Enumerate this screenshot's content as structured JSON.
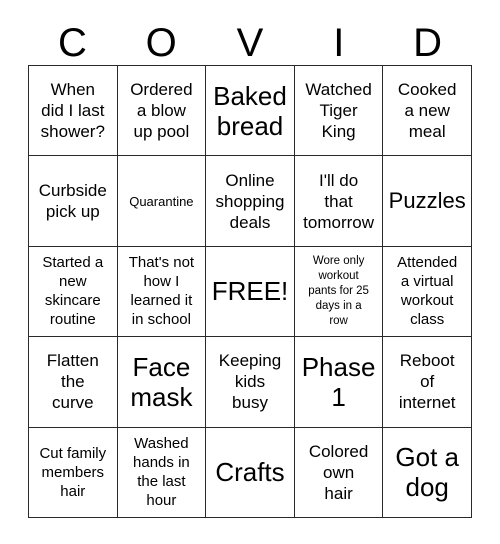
{
  "card": {
    "title_letters": [
      "C",
      "O",
      "V",
      "I",
      "D"
    ],
    "free_space_label": "FREE!",
    "grid": {
      "rows": 5,
      "columns": 5
    },
    "cells": [
      {
        "text": "When\ndid I last\nshower?",
        "size": "md"
      },
      {
        "text": "Ordered\na blow\nup pool",
        "size": "md"
      },
      {
        "text": "Baked\nbread",
        "size": "xl"
      },
      {
        "text": "Watched\nTiger\nKing",
        "size": "md"
      },
      {
        "text": "Cooked\na new\nmeal",
        "size": "md"
      },
      {
        "text": "Curbside\npick up",
        "size": "md"
      },
      {
        "text": "Quarantine",
        "size": "xs"
      },
      {
        "text": "Online\nshopping\ndeals",
        "size": "md"
      },
      {
        "text": "I'll do\nthat\ntomorrow",
        "size": "md"
      },
      {
        "text": "Puzzles",
        "size": "lg"
      },
      {
        "text": "Started a\nnew\nskincare\nroutine",
        "size": "sm"
      },
      {
        "text": "That's not\nhow I\nlearned it\nin school",
        "size": "sm"
      },
      {
        "text": "FREE!",
        "size": "xl"
      },
      {
        "text": "Wore only\nworkout\npants for 25\ndays in a\nrow",
        "size": "xxs"
      },
      {
        "text": "Attended\na virtual\nworkout\nclass",
        "size": "sm"
      },
      {
        "text": "Flatten\nthe\ncurve",
        "size": "md"
      },
      {
        "text": "Face\nmask",
        "size": "xl"
      },
      {
        "text": "Keeping\nkids\nbusy",
        "size": "md"
      },
      {
        "text": "Phase\n1",
        "size": "xl"
      },
      {
        "text": "Reboot\nof\ninternet",
        "size": "md"
      },
      {
        "text": "Cut family\nmembers\nhair",
        "size": "sm"
      },
      {
        "text": "Washed\nhands in\nthe last\nhour",
        "size": "sm"
      },
      {
        "text": "Crafts",
        "size": "xl"
      },
      {
        "text": "Colored\nown\nhair",
        "size": "md"
      },
      {
        "text": "Got a\ndog",
        "size": "xl"
      }
    ]
  },
  "colors": {
    "background": "#ffffff",
    "text": "#000000",
    "border": "#2a2a2a"
  }
}
